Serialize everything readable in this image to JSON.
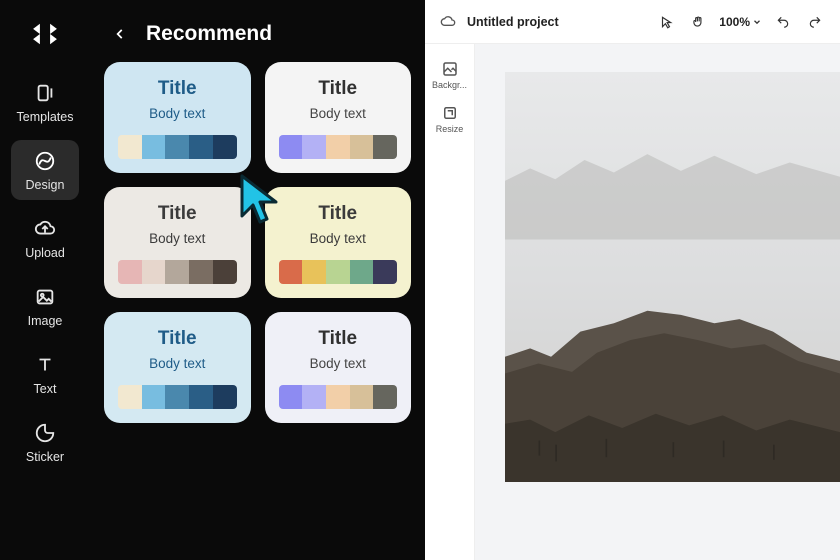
{
  "rail": {
    "items": [
      {
        "label": "Templates"
      },
      {
        "label": "Design"
      },
      {
        "label": "Upload"
      },
      {
        "label": "Image"
      },
      {
        "label": "Text"
      },
      {
        "label": "Sticker"
      }
    ],
    "active_index": 1
  },
  "panel": {
    "title": "Recommend",
    "cards": [
      {
        "title": "Title",
        "body": "Body text",
        "bg": "#cfe6f2",
        "title_color": "#1f5c88",
        "body_color": "#1f5c88",
        "swatches": [
          "#f2e8d0",
          "#78bde0",
          "#4a88ad",
          "#2a5e86",
          "#1d3c5e"
        ]
      },
      {
        "title": "Title",
        "body": "Body text",
        "bg": "#f4f4f4",
        "title_color": "#303030",
        "body_color": "#444444",
        "swatches": [
          "#8d8bf2",
          "#b3b1f5",
          "#f2cfa8",
          "#d7c099",
          "#66665e"
        ]
      },
      {
        "title": "Title",
        "body": "Body text",
        "bg": "#ece9e4",
        "title_color": "#3b3b3b",
        "body_color": "#3b3b3b",
        "swatches": [
          "#e6b6b5",
          "#e6d6cc",
          "#b3a79b",
          "#7a6d62",
          "#4b4039"
        ]
      },
      {
        "title": "Title",
        "body": "Body text",
        "bg": "#f4f2cf",
        "title_color": "#3b3b3b",
        "body_color": "#3b3b3b",
        "swatches": [
          "#d96b4a",
          "#e8c25a",
          "#b8d492",
          "#6ea88a",
          "#3a3a5a"
        ]
      },
      {
        "title": "Title",
        "body": "Body text",
        "bg": "#d4e9f2",
        "title_color": "#1f5c88",
        "body_color": "#1f5c88",
        "swatches": [
          "#f2e8d0",
          "#78bde0",
          "#4a88ad",
          "#2a5e86",
          "#1d3c5e"
        ]
      },
      {
        "title": "Title",
        "body": "Body text",
        "bg": "#eff0f7",
        "title_color": "#303030",
        "body_color": "#444444",
        "swatches": [
          "#8d8bf2",
          "#b3b1f5",
          "#f2cfa8",
          "#d7c099",
          "#66665e"
        ]
      }
    ]
  },
  "editor": {
    "project_name": "Untitled project",
    "zoom": "100%",
    "tools": [
      {
        "label": "Backgr..."
      },
      {
        "label": "Resize"
      }
    ]
  }
}
